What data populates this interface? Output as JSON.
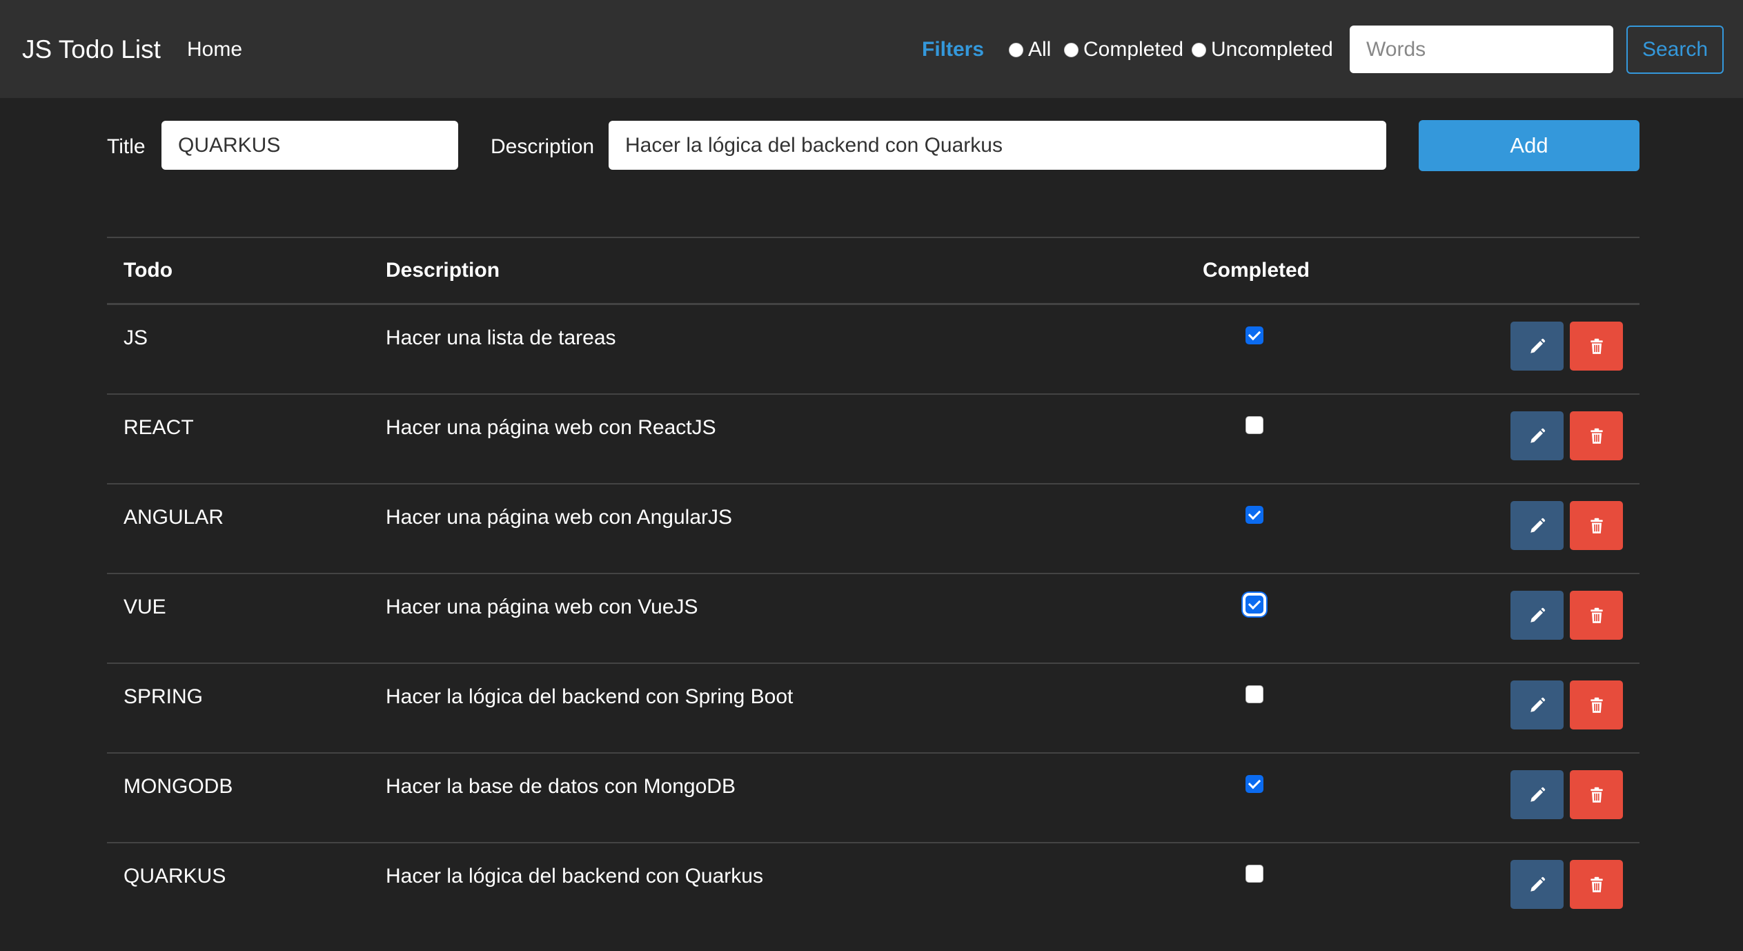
{
  "navbar": {
    "brand": "JS Todo List",
    "home": "Home",
    "filters_label": "Filters",
    "filter_options": [
      {
        "label": "All",
        "selected": false
      },
      {
        "label": "Completed",
        "selected": false
      },
      {
        "label": "Uncompleted",
        "selected": false
      }
    ],
    "search_placeholder": "Words",
    "search_button": "Search"
  },
  "form": {
    "title_label": "Title",
    "title_value": "QUARKUS",
    "description_label": "Description",
    "description_value": "Hacer la lógica del backend con Quarkus",
    "add_button": "Add"
  },
  "table": {
    "headers": {
      "todo": "Todo",
      "description": "Description",
      "completed": "Completed"
    },
    "rows": [
      {
        "todo": "JS",
        "description": "Hacer una lista de tareas",
        "completed": true
      },
      {
        "todo": "REACT",
        "description": "Hacer una página web con ReactJS",
        "completed": false
      },
      {
        "todo": "ANGULAR",
        "description": "Hacer una página web con AngularJS",
        "completed": true
      },
      {
        "todo": "VUE",
        "description": "Hacer una página web con VueJS",
        "completed": true,
        "focused": true
      },
      {
        "todo": "SPRING",
        "description": "Hacer la lógica del backend con Spring Boot",
        "completed": false
      },
      {
        "todo": "MONGODB",
        "description": "Hacer la base de datos con MongoDB",
        "completed": true
      },
      {
        "todo": "QUARKUS",
        "description": "Hacer la lógica del backend con Quarkus",
        "completed": false
      }
    ]
  },
  "icons": {
    "edit": "pencil-icon",
    "delete": "trash-icon"
  },
  "colors": {
    "background": "#222222",
    "navbar": "#303030",
    "accent": "#3498db",
    "edit_button": "#375a7f",
    "delete_button": "#e74c3c",
    "checkbox_checked": "#0b6bf0"
  }
}
